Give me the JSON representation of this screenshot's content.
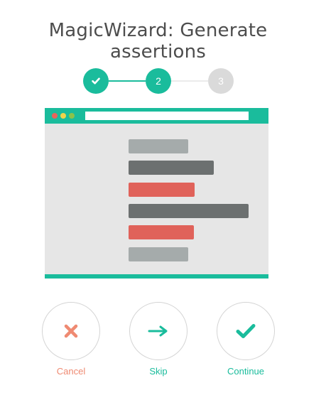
{
  "title": "MagicWizard: Generate assertions",
  "stepper": {
    "steps": [
      {
        "label": "",
        "state": "complete"
      },
      {
        "label": "2",
        "state": "active"
      },
      {
        "label": "3",
        "state": "pending"
      }
    ]
  },
  "preview": {
    "bars": [
      {
        "color": "#a5abab"
      },
      {
        "color": "#6c7070"
      },
      {
        "color": "#e0625a"
      },
      {
        "color": "#6c7070"
      },
      {
        "color": "#e0625a"
      },
      {
        "color": "#a5abab"
      }
    ]
  },
  "actions": {
    "cancel": {
      "label": "Cancel",
      "color": "#ef8a72"
    },
    "skip": {
      "label": "Skip",
      "color": "#1abc9c"
    },
    "continue": {
      "label": "Continue",
      "color": "#1abc9c"
    }
  },
  "colors": {
    "accent": "#1abc9c",
    "pending": "#dadada",
    "danger": "#ef8a72"
  }
}
